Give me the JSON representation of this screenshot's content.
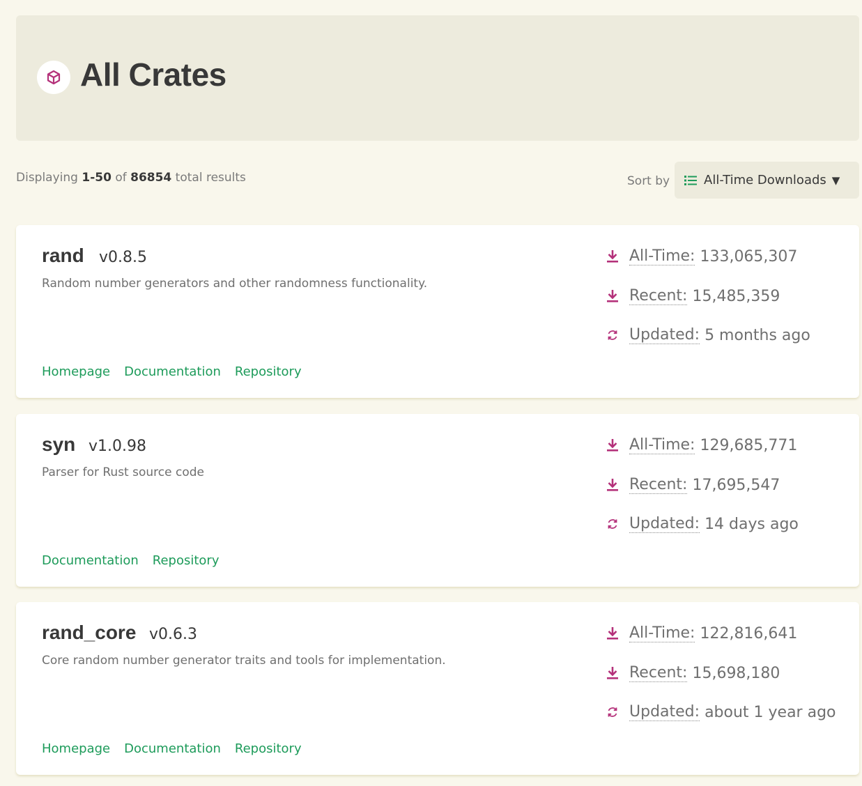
{
  "header": {
    "title": "All Crates",
    "icon": "cube-icon"
  },
  "results": {
    "prefix": "Displaying",
    "range": "1-50",
    "of": "of",
    "total": "86854",
    "suffix": "total results"
  },
  "sort": {
    "label": "Sort by",
    "value": "All-Time Downloads",
    "caret": "▼"
  },
  "labels": {
    "all_time": "All-Time:",
    "recent": "Recent:",
    "updated": "Updated:"
  },
  "crates": [
    {
      "name": "rand",
      "version": "v0.8.5",
      "description": "Random number generators and other randomness functionality.",
      "all_time": "133,065,307",
      "recent": "15,485,359",
      "updated": "5 months ago",
      "links": [
        "Homepage",
        "Documentation",
        "Repository"
      ]
    },
    {
      "name": "syn",
      "version": "v1.0.98",
      "description": "Parser for Rust source code",
      "all_time": "129,685,771",
      "recent": "17,695,547",
      "updated": "14 days ago",
      "links": [
        "Documentation",
        "Repository"
      ]
    },
    {
      "name": "rand_core",
      "version": "v0.6.3",
      "description": "Core random number generator traits and tools for implementation.",
      "all_time": "122,816,641",
      "recent": "15,698,180",
      "updated": "about 1 year ago",
      "links": [
        "Homepage",
        "Documentation",
        "Repository"
      ]
    }
  ],
  "colors": {
    "accent_green": "#1d9b5a",
    "icon_magenta": "#b4317a",
    "background": "#f9f7ec"
  }
}
